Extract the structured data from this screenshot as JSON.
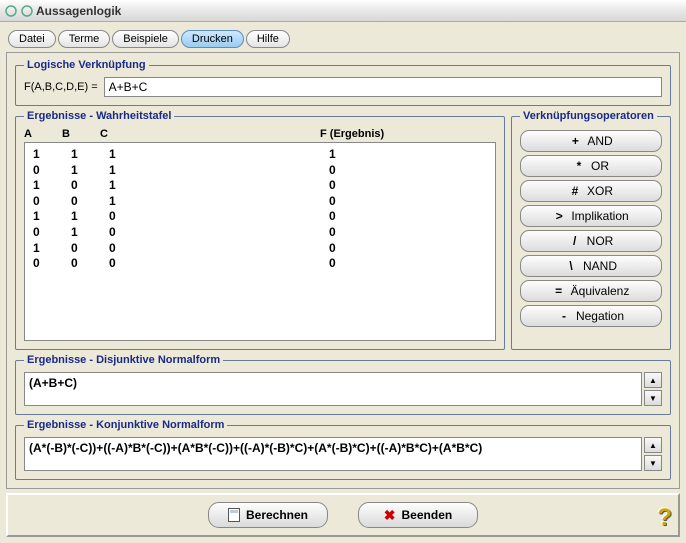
{
  "window": {
    "title": "Aussagenlogik"
  },
  "tabs": [
    {
      "label": "Datei"
    },
    {
      "label": "Terme"
    },
    {
      "label": "Beispiele"
    },
    {
      "label": "Drucken",
      "active": true
    },
    {
      "label": "Hilfe"
    }
  ],
  "logic": {
    "legend": "Logische Verknüpfung",
    "label": "F(A,B,C,D,E) =",
    "value": "A+B+C"
  },
  "truth": {
    "legend": "Ergebnisse - Wahrheitstafel",
    "headers": {
      "A": "A",
      "B": "B",
      "C": "C",
      "F": "F (Ergebnis)"
    },
    "rows": [
      {
        "A": "1",
        "B": "1",
        "C": "1",
        "F": "1"
      },
      {
        "A": "0",
        "B": "1",
        "C": "1",
        "F": "0"
      },
      {
        "A": "1",
        "B": "0",
        "C": "1",
        "F": "0"
      },
      {
        "A": "0",
        "B": "0",
        "C": "1",
        "F": "0"
      },
      {
        "A": "1",
        "B": "1",
        "C": "0",
        "F": "0"
      },
      {
        "A": "0",
        "B": "1",
        "C": "0",
        "F": "0"
      },
      {
        "A": "1",
        "B": "0",
        "C": "0",
        "F": "0"
      },
      {
        "A": "0",
        "B": "0",
        "C": "0",
        "F": "0"
      }
    ]
  },
  "ops": {
    "legend": "Verknüpfungsoperatoren",
    "items": [
      {
        "sym": "+",
        "label": "AND"
      },
      {
        "sym": "*",
        "label": "OR"
      },
      {
        "sym": "#",
        "label": "XOR"
      },
      {
        "sym": ">",
        "label": "Implikation"
      },
      {
        "sym": "/",
        "label": "NOR"
      },
      {
        "sym": "\\",
        "label": "NAND"
      },
      {
        "sym": "=",
        "label": "Äquivalenz"
      },
      {
        "sym": "-",
        "label": "Negation"
      }
    ]
  },
  "dnf": {
    "legend": "Ergebnisse - Disjunktive Normalform",
    "value": "(A+B+C)"
  },
  "knf": {
    "legend": "Ergebnisse - Konjunktive Normalform",
    "value": "(A*(-B)*(-C))+((-A)*B*(-C))+(A*B*(-C))+((-A)*(-B)*C)+(A*(-B)*C)+((-A)*B*C)+(A*B*C)"
  },
  "buttons": {
    "compute": "Berechnen",
    "exit": "Beenden"
  },
  "help_glyph": "?"
}
